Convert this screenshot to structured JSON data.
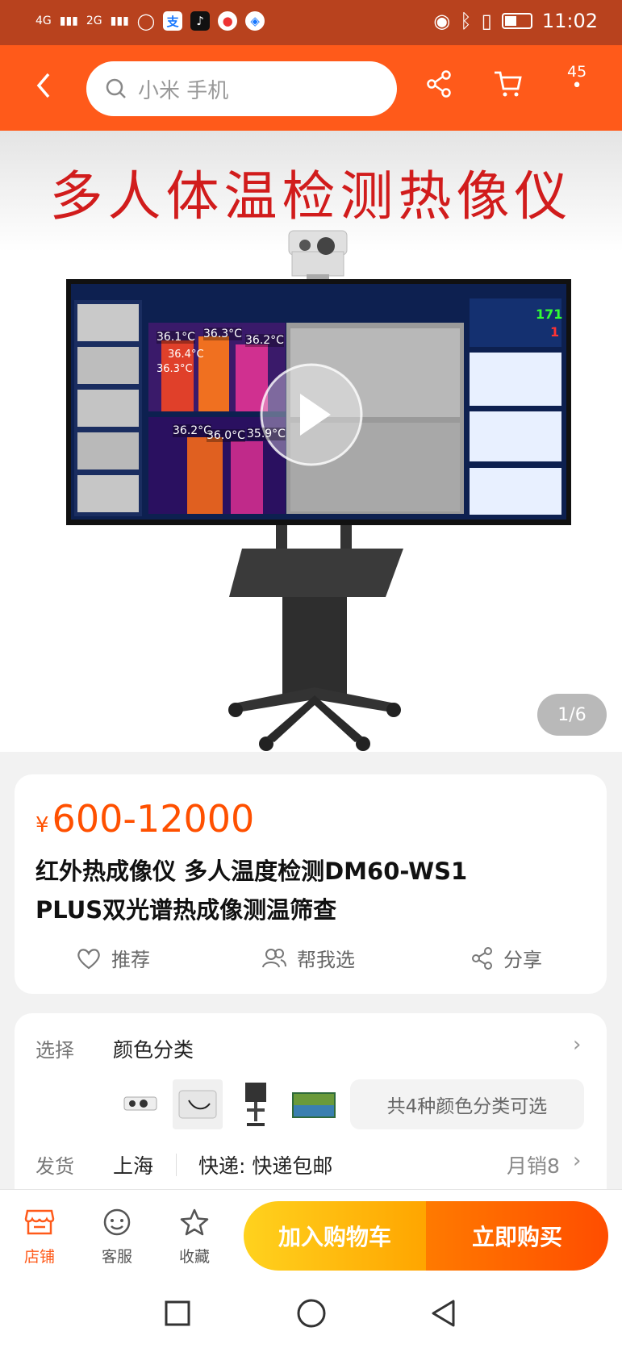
{
  "status_bar": {
    "signal_1": "4G",
    "signal_2": "2G",
    "app_icons": [
      "message-icon",
      "alipay-icon",
      "tiktok-icon",
      "music-icon",
      "browser-icon"
    ],
    "time": "11:02"
  },
  "header": {
    "search_placeholder": "小米 手机",
    "cart_badge": "45"
  },
  "gallery": {
    "banner_text": "多人体温检测热像仪",
    "counter": "1/6",
    "screen_readouts": [
      "36.1°C",
      "36.3°C",
      "36.2°C",
      "36.4°C",
      "36.3°C",
      "36.2°C",
      "36.0°C",
      "35.9°C"
    ],
    "side_numbers": [
      "171",
      "1"
    ]
  },
  "product": {
    "currency": "¥",
    "price": "600-12000",
    "title_line1": "红外热成像仪 多人温度检测DM60-WS1",
    "title_line2": "PLUS双光谱热成像测温筛查",
    "actions": {
      "recommend": "推荐",
      "help_choose": "帮我选",
      "share": "分享"
    }
  },
  "options": {
    "select_label": "选择",
    "select_value": "颜色分类",
    "variants_summary": "共4种颜色分类可选",
    "ship_label": "发货",
    "ship_from": "上海",
    "delivery": "快递: 快递包邮",
    "monthly_sales": "月销8"
  },
  "bottom_bar": {
    "shop": "店铺",
    "service": "客服",
    "favorite": "收藏",
    "add_to_cart": "加入购物车",
    "buy_now": "立即购买"
  },
  "colors": {
    "accent": "#ff5a1a",
    "status_bar": "#b8421e",
    "price": "#ff5000"
  }
}
